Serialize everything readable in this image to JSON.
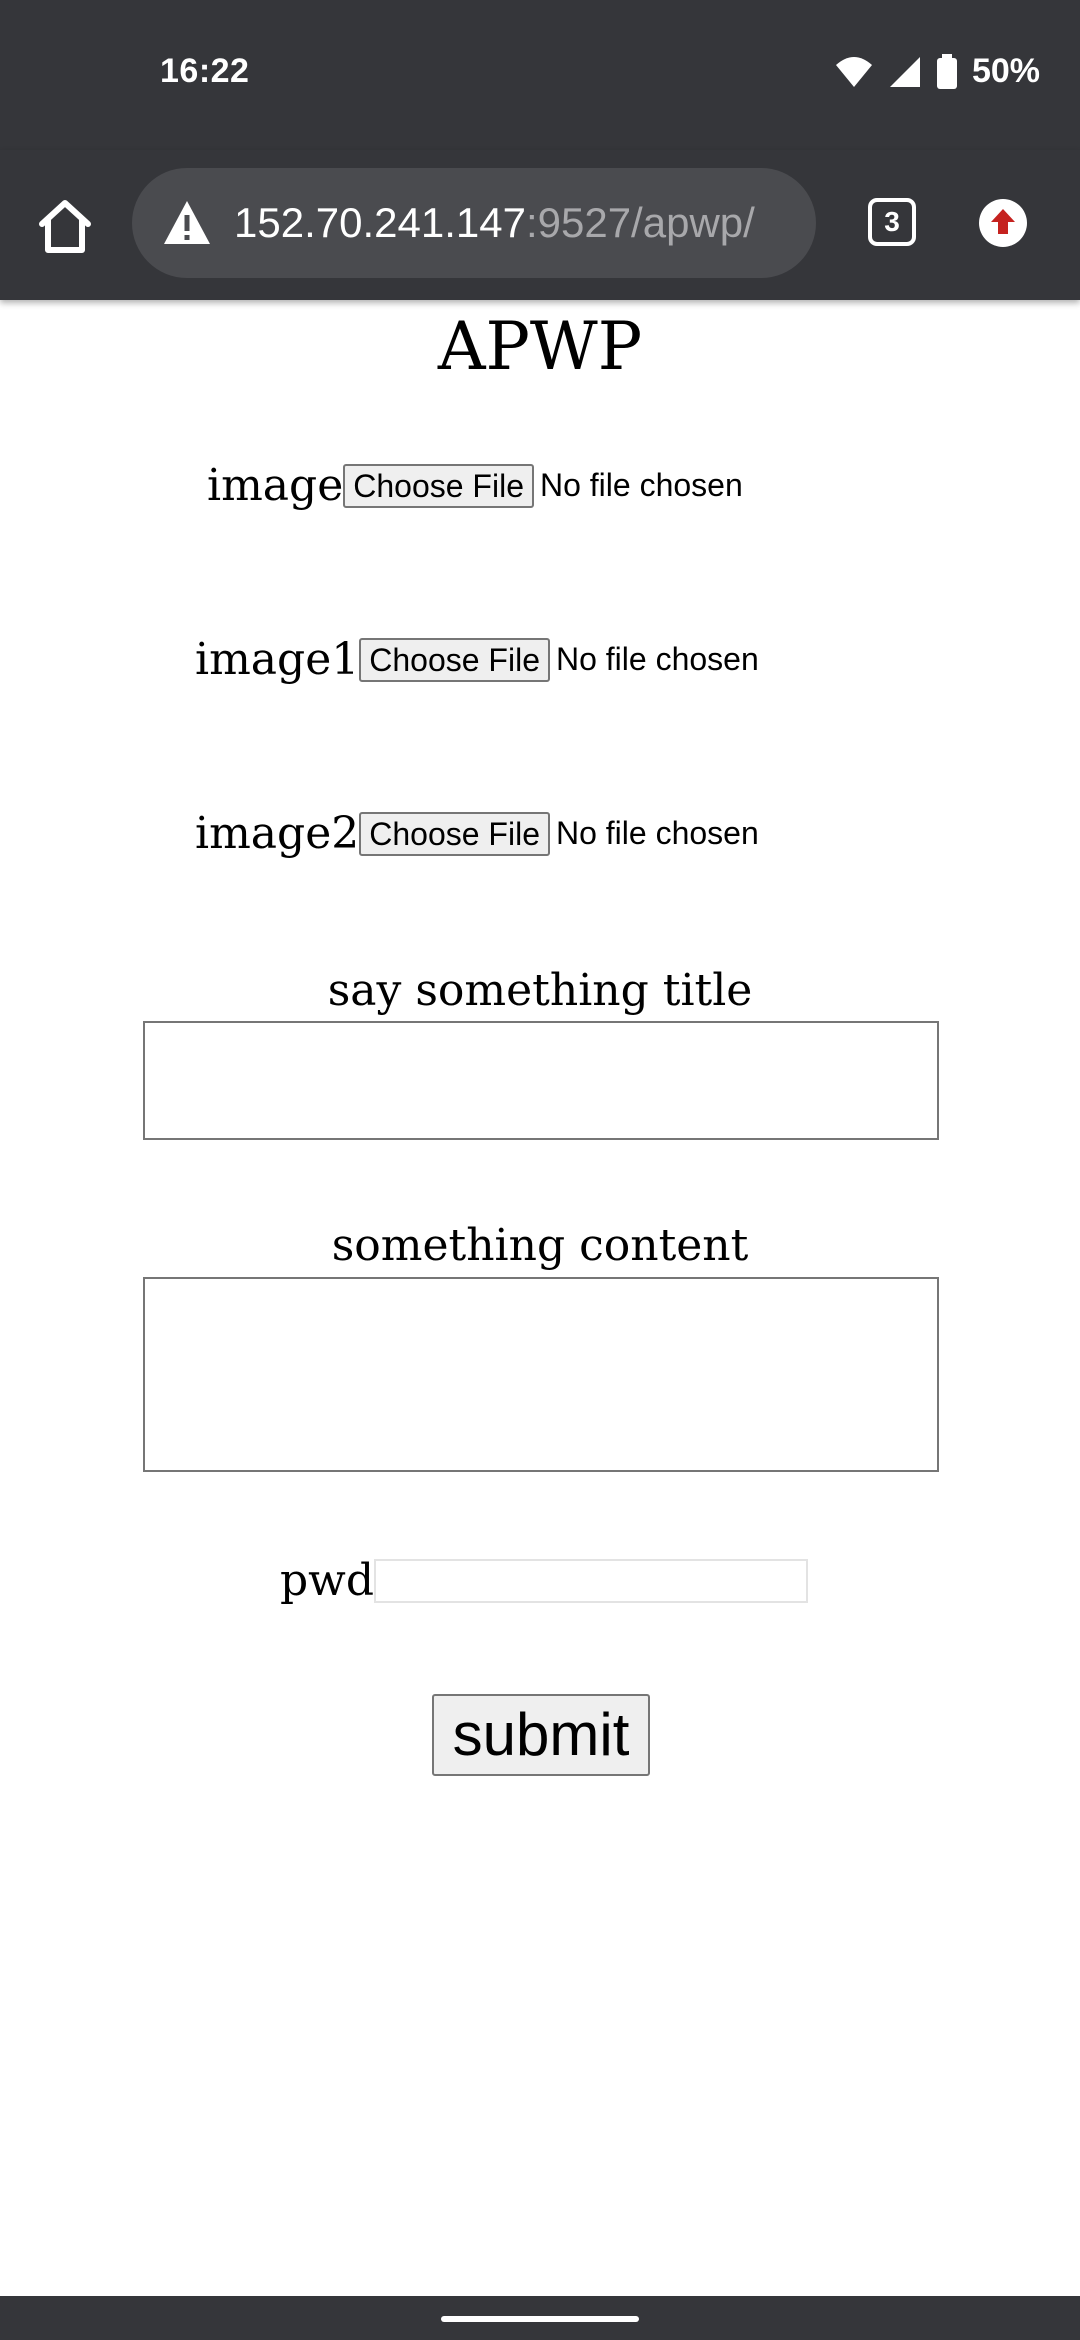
{
  "status_bar": {
    "time": "16:22",
    "battery": "50%"
  },
  "browser": {
    "url_host": "152.70.241.147",
    "url_path": ":9527/apwp/",
    "tab_count": "3"
  },
  "page": {
    "title": "APWP",
    "file_inputs": [
      {
        "label": "image",
        "button": "Choose File",
        "status": "No file chosen"
      },
      {
        "label": "image1",
        "button": "Choose File",
        "status": "No file chosen"
      },
      {
        "label": "image2",
        "button": "Choose File",
        "status": "No file chosen"
      }
    ],
    "title_field": {
      "label": "say something title",
      "value": ""
    },
    "content_field": {
      "label": "something content",
      "value": ""
    },
    "pwd_field": {
      "label": "pwd",
      "value": ""
    },
    "submit_label": "submit"
  },
  "icons": [
    "home-icon",
    "warning-icon",
    "tab-switcher-icon",
    "update-icon",
    "wifi-icon",
    "signal-icon",
    "battery-icon"
  ],
  "colors": {
    "chrome_bg": "#35363a",
    "url_pill": "#4a4b4f",
    "update_red": "#c5221f"
  }
}
